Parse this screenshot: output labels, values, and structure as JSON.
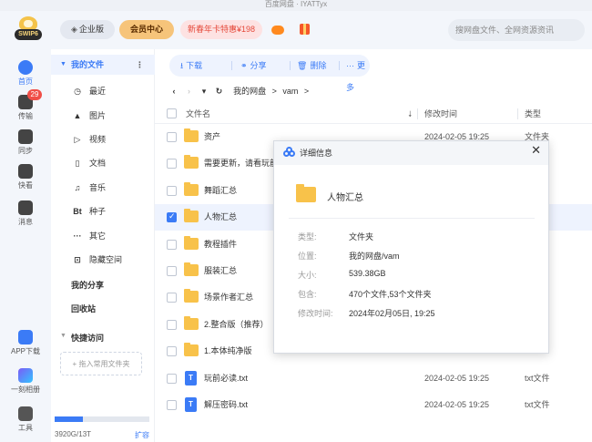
{
  "window": {
    "title": "百度网盘 · IYATTyx"
  },
  "topbar": {
    "svip_label": "SWIP6",
    "enterprise": "企业版",
    "vip_center": "会员中心",
    "promo": "新春年卡特惠¥198",
    "search_placeholder": "搜网盘文件、全网资源资讯"
  },
  "rail": {
    "home": "首页",
    "transfer": "传输",
    "transfer_badge": "29",
    "sync": "同步",
    "quick": "快看",
    "messages": "消息",
    "app_download": "APP下载",
    "cut": "一刻相册",
    "tools": "工具"
  },
  "nav": {
    "my_files": "我的文件",
    "items": [
      "最近",
      "图片",
      "视频",
      "文档",
      "音乐",
      "种子",
      "其它",
      "隐藏空间"
    ],
    "my_share": "我的分享",
    "recycle": "回收站",
    "quick_access": "快捷访问",
    "add_folder": "+ 拖入常用文件夹",
    "storage": "3920G/13T",
    "storage_fraction": 0.3,
    "expand": "扩容"
  },
  "toolbar": {
    "download": "下载",
    "share": "分享",
    "delete": "删除",
    "more": "更多"
  },
  "path": {
    "root": "我的网盘",
    "sep": ">",
    "folder": "vam",
    "end": ">"
  },
  "table": {
    "col_name": "文件名",
    "col_time": "修改时间",
    "col_type": "类型",
    "rows": [
      {
        "name": "资产",
        "date": "2024-02-05 19:25",
        "type": "文件夹",
        "kind": "folder",
        "selected": false
      },
      {
        "name": "需要更新，请看玩前",
        "date": "",
        "type": "",
        "kind": "folder",
        "selected": false
      },
      {
        "name": "舞蹈汇总",
        "date": "",
        "type": "",
        "kind": "folder",
        "selected": false
      },
      {
        "name": "人物汇总",
        "date": "",
        "type": "",
        "kind": "folder",
        "selected": true
      },
      {
        "name": "教程插件",
        "date": "",
        "type": "",
        "kind": "folder",
        "selected": false
      },
      {
        "name": "服装汇总",
        "date": "",
        "type": "",
        "kind": "folder",
        "selected": false
      },
      {
        "name": "场景作者汇总",
        "date": "",
        "type": "",
        "kind": "folder",
        "selected": false
      },
      {
        "name": "2.整合版（推荐）",
        "date": "",
        "type": "",
        "kind": "folder",
        "selected": false
      },
      {
        "name": "1.本体纯净版",
        "date": "",
        "type": "",
        "kind": "folder",
        "selected": false
      },
      {
        "name": "玩前必读.txt",
        "date": "2024-02-05 19:25",
        "type": "txt文件",
        "kind": "txt",
        "selected": false
      },
      {
        "name": "解压密码.txt",
        "date": "2024-02-05 19:25",
        "type": "txt文件",
        "kind": "txt",
        "selected": false
      }
    ]
  },
  "modal": {
    "title": "详细信息",
    "close": "✕",
    "name": "人物汇总",
    "fields": [
      {
        "k": "类型:",
        "v": "文件夹"
      },
      {
        "k": "位置:",
        "v": "我的网盘/vam"
      },
      {
        "k": "大小:",
        "v": "539.38GB"
      },
      {
        "k": "包含:",
        "v": "470个文件,53个文件夹"
      },
      {
        "k": "修改时间:",
        "v": "2024年02月05日, 19:25"
      }
    ]
  },
  "colors": {
    "accent": "#3b7bf6",
    "folder": "#f8c24a",
    "badge": "#f04e47"
  }
}
